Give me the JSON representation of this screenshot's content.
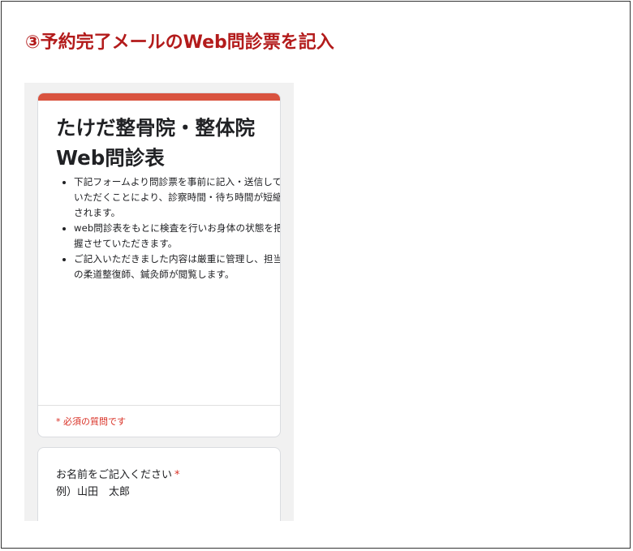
{
  "heading": "③予約完了メールのWeb問診票を記入",
  "form": {
    "title": "たけだ整骨院・整体院　Web問診表",
    "description_items": [
      "下記フォームより問診票を事前に記入・送信していただくことにより、診察時間・待ち時間が短縮されます。",
      "web問診表をもとに検査を行いお身体の状態を把握させていただきます。",
      "ご記入いただきました内容は厳重に管理し、担当の柔道整復師、鍼灸師が閲覧します。"
    ],
    "required_note": "* 必須の質問です"
  },
  "question": {
    "label": "お名前をご記入ください",
    "required_mark": "*",
    "hint": "例）山田　太郎"
  },
  "colors": {
    "heading": "#b31b1b",
    "accent": "#d9533f",
    "required": "#d93025"
  }
}
